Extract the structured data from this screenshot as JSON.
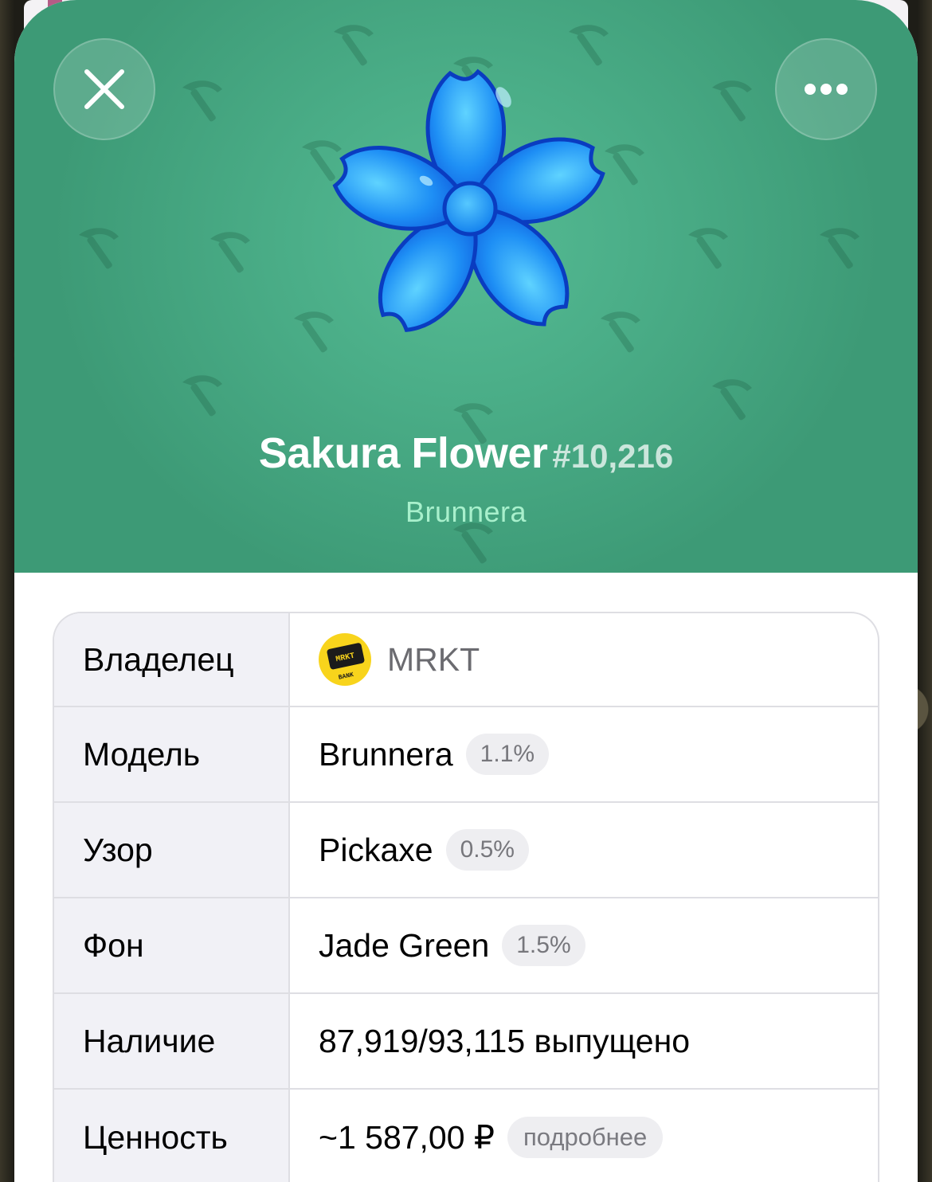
{
  "header": {
    "close_icon": "close-icon",
    "more_icon": "more-horizontal-icon",
    "gift_name": "Sakura Flower",
    "gift_number": "#10,216",
    "model_subtitle": "Brunnera",
    "background_color": "#4aad87",
    "pattern_icon": "pickaxe-icon",
    "gift_image": "blue-flower-icon"
  },
  "details": {
    "owner": {
      "label": "Владелец",
      "name": "MRKT",
      "avatar_top": "MRKT",
      "avatar_bottom": "BANK"
    },
    "model": {
      "label": "Модель",
      "value": "Brunnera",
      "rarity": "1.1%"
    },
    "pattern": {
      "label": "Узор",
      "value": "Pickaxe",
      "rarity": "0.5%"
    },
    "backdrop": {
      "label": "Фон",
      "value": "Jade Green",
      "rarity": "1.5%"
    },
    "availability": {
      "label": "Наличие",
      "value": "87,919/93,115 выпущено"
    },
    "value": {
      "label": "Ценность",
      "amount": "~1 587,00 ₽",
      "more_link": "подробнее"
    }
  }
}
